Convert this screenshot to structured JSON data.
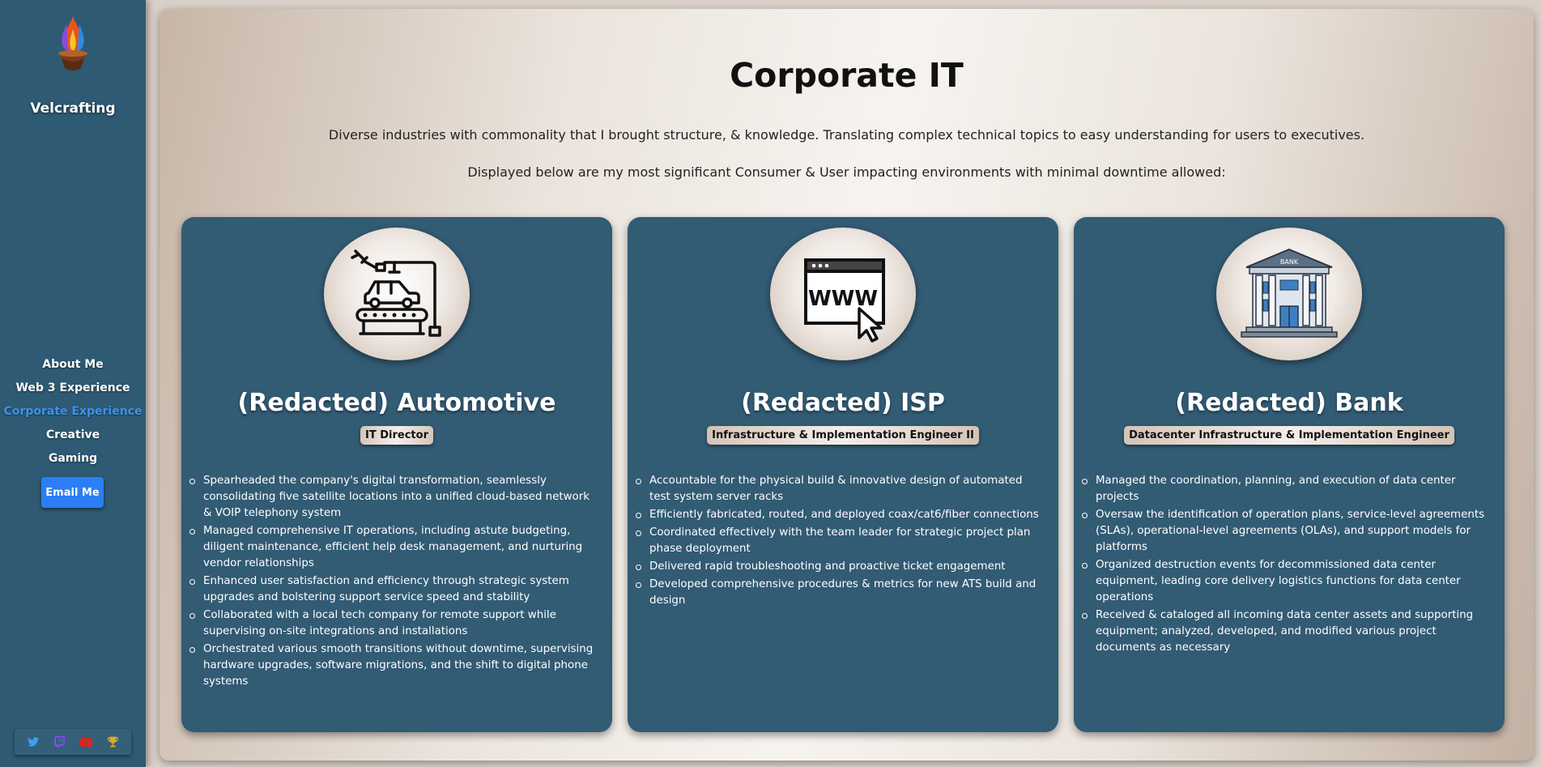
{
  "sidebar": {
    "brand": "Velcrafting",
    "nav": [
      "About Me",
      "Web 3 Experience",
      "Corporate Experience",
      "Creative",
      "Gaming"
    ],
    "active_nav": "Corporate Experience",
    "email_button": "Email Me",
    "social_icons": [
      "twitter-icon",
      "twitch-icon",
      "youtube-icon",
      "trophy-icon"
    ]
  },
  "main": {
    "title": "Corporate IT",
    "intro1": "Diverse industries with commonality that I brought structure, & knowledge. Translating complex technical topics to easy understanding for users to executives.",
    "intro2": "Displayed below are my most significant Consumer & User impacting environments with minimal downtime allowed:",
    "cards": [
      {
        "icon": "automotive-assembly-icon",
        "title": "(Redacted) Automotive",
        "role": "IT Director",
        "bullets": [
          "Spearheaded the company's digital transformation, seamlessly consolidating five satellite locations into a unified cloud-based network & VOIP telephony system",
          "Managed comprehensive IT operations, including astute budgeting, diligent maintenance, efficient help desk management, and nurturing vendor relationships",
          "Enhanced user satisfaction and efficiency through strategic system upgrades and bolstering support service speed and stability",
          "Collaborated with a local tech company for remote support while supervising on-site integrations and installations",
          "Orchestrated various smooth transitions without downtime, supervising hardware upgrades, software migrations, and the shift to digital phone systems"
        ]
      },
      {
        "icon": "www-browser-icon",
        "title": "(Redacted) ISP",
        "role": "Infrastructure & Implementation Engineer II",
        "bullets": [
          "Accountable for the physical build & innovative design of automated test system server racks",
          "Efficiently fabricated, routed, and deployed coax/cat6/fiber connections",
          "Coordinated effectively with the team leader for strategic project plan phase deployment",
          "Delivered rapid troubleshooting and proactive ticket engagement",
          "Developed comprehensive procedures & metrics for new ATS build and design"
        ]
      },
      {
        "icon": "bank-building-icon",
        "title": "(Redacted) Bank",
        "role": "Datacenter Infrastructure & Implementation Engineer",
        "bank_sign": "BANK",
        "bullets": [
          "Managed the coordination, planning, and execution of data center projects",
          "Oversaw the identification of operation plans, service-level agreements (SLAs), operational-level agreements (OLAs), and support models for platforms",
          "Organized destruction events for decommissioned data center equipment, leading core delivery logistics functions for data center operations",
          "Received & cataloged all incoming data center assets and supporting equipment; analyzed, developed, and modified various project documents as necessary"
        ]
      }
    ]
  },
  "colors": {
    "sidebar": "#2e5a73",
    "card": "#325b74",
    "accent": "#3b93f0",
    "button": "#2b7ef6"
  }
}
